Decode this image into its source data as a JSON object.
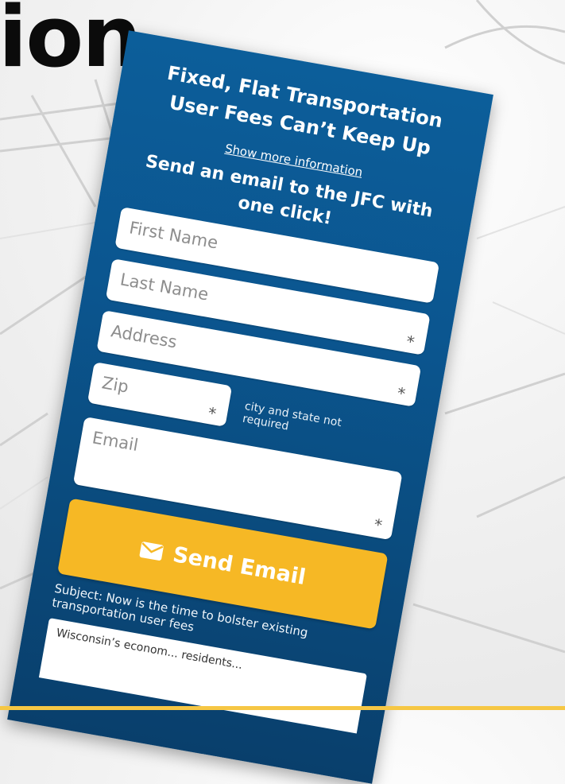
{
  "headline_fragment": "ion",
  "form": {
    "title": "Fixed, Flat Transportation User Fees Can’t Keep Up",
    "more_info_link": "Show more information",
    "cta_title": "Send an email to the JFC with one click!",
    "fields": {
      "first_name_placeholder": "First Name",
      "last_name_placeholder": "Last Name",
      "address_placeholder": "Address",
      "zip_placeholder": "Zip",
      "email_placeholder": "Email",
      "required_marker": "*"
    },
    "zip_note": "city and state not required",
    "send_button_label": "Send Email",
    "subject_line": "Subject: Now is the time to bolster existing transportation user fees",
    "message_preview": "Wisconsin’s econom... residents..."
  },
  "colors": {
    "panel_top": "#0c5e9a",
    "panel_bottom": "#093f6c",
    "button": "#f6b825",
    "accent_bar": "#f6c744"
  },
  "icons": {
    "send_button_icon": "envelope-icon"
  }
}
